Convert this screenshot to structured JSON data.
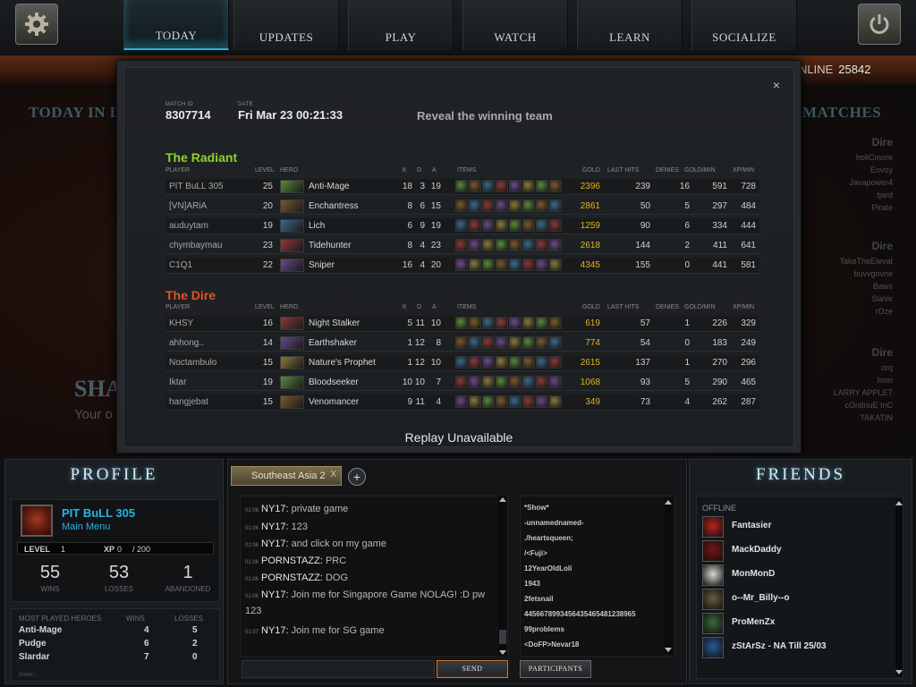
{
  "nav": {
    "tabs": [
      "TODAY",
      "UPDATES",
      "PLAY",
      "WATCH",
      "LEARN",
      "SOCIALIZE"
    ],
    "active": "TODAY",
    "settings_icon": "gear-icon",
    "power_icon": "power-icon"
  },
  "background": {
    "today_title": "TODAY IN D",
    "matches_title": "MATCHES",
    "online_label": "NLINE",
    "online_count": "25842",
    "headline": "SHA",
    "subline": "Your o",
    "right_groups": [
      {
        "title": "Dire",
        "names": [
          "holiCmore",
          "Envoy",
          "Javapower4",
          "tjard",
          "Pirate"
        ]
      },
      {
        "title": "Dire",
        "names": [
          "TakeTheElevat",
          "buvvgovne",
          "Baws",
          "SlaVe",
          "rOze"
        ]
      },
      {
        "title": "Dire",
        "names": [
          "orq",
          "Inori",
          "LARRY APPLET",
          "cOntinuE InC",
          "TAKATIN"
        ]
      }
    ]
  },
  "match": {
    "id_label": "MATCH ID",
    "id": "8307714",
    "date_label": "DATE",
    "date": "Fri Mar 23 00:21:33",
    "reveal": "Reveal the winning team",
    "close": "×",
    "columns": {
      "player": "PLAYER",
      "level": "LEVEL",
      "hero": "HERO",
      "k": "K",
      "d": "D",
      "a": "A",
      "items": "ITEMS",
      "gold": "GOLD",
      "last_hits": "LAST HITS",
      "denies": "DENIES",
      "gpm": "GOLD/MIN",
      "xpm": "XP/MIN"
    },
    "radiant": {
      "title": "The Radiant",
      "players": [
        {
          "player": "PIT BuLL 305",
          "level": "25",
          "hero": "Anti-Mage",
          "k": "18",
          "d": "3",
          "a": "19",
          "gold": "2396",
          "lh": "239",
          "den": "16",
          "gpm": "591",
          "xpm": "728"
        },
        {
          "player": "[VN]ARiA",
          "level": "20",
          "hero": "Enchantress",
          "k": "8",
          "d": "6",
          "a": "15",
          "gold": "2861",
          "lh": "50",
          "den": "5",
          "gpm": "297",
          "xpm": "484"
        },
        {
          "player": "auduytam",
          "level": "19",
          "hero": "Lich",
          "k": "6",
          "d": "9",
          "a": "19",
          "gold": "1259",
          "lh": "90",
          "den": "6",
          "gpm": "334",
          "xpm": "444"
        },
        {
          "player": "chymbaymau",
          "level": "23",
          "hero": "Tidehunter",
          "k": "8",
          "d": "4",
          "a": "23",
          "gold": "2618",
          "lh": "144",
          "den": "2",
          "gpm": "411",
          "xpm": "641"
        },
        {
          "player": "C1Q1",
          "level": "22",
          "hero": "Sniper",
          "k": "16",
          "d": "4",
          "a": "20",
          "gold": "4345",
          "lh": "155",
          "den": "0",
          "gpm": "441",
          "xpm": "581"
        }
      ]
    },
    "dire": {
      "title": "The Dire",
      "players": [
        {
          "player": "KHSY",
          "level": "16",
          "hero": "Night Stalker",
          "k": "5",
          "d": "11",
          "a": "10",
          "gold": "619",
          "lh": "57",
          "den": "1",
          "gpm": "226",
          "xpm": "329"
        },
        {
          "player": "ahhong..",
          "level": "14",
          "hero": "Earthshaker",
          "k": "1",
          "d": "12",
          "a": "8",
          "gold": "774",
          "lh": "54",
          "den": "0",
          "gpm": "183",
          "xpm": "249"
        },
        {
          "player": "Noctambulo",
          "level": "15",
          "hero": "Nature's Prophet",
          "k": "1",
          "d": "12",
          "a": "10",
          "gold": "2615",
          "lh": "137",
          "den": "1",
          "gpm": "270",
          "xpm": "296"
        },
        {
          "player": "Iktar",
          "level": "19",
          "hero": "Bloodseeker",
          "k": "10",
          "d": "10",
          "a": "7",
          "gold": "1068",
          "lh": "93",
          "den": "5",
          "gpm": "290",
          "xpm": "465"
        },
        {
          "player": "hangjebat",
          "level": "15",
          "hero": "Venomancer",
          "k": "9",
          "d": "11",
          "a": "4",
          "gold": "349",
          "lh": "73",
          "den": "4",
          "gpm": "262",
          "xpm": "287"
        }
      ]
    },
    "replay": "Replay Unavailable"
  },
  "profile": {
    "title": "PROFILE",
    "name": "PIT BuLL 305",
    "status": "Main Menu",
    "level_label": "LEVEL",
    "level": "1",
    "xp_label": "XP",
    "xp": "0",
    "xp_max": "/ 200",
    "wins": "55",
    "wins_label": "WINS",
    "losses": "53",
    "losses_label": "LOSSES",
    "abandoned": "1",
    "abandoned_label": "ABANDONED",
    "mph_label": "MOST PLAYED HEROES",
    "mph_wins_label": "WINS",
    "mph_losses_label": "LOSSES",
    "heroes": [
      {
        "name": "Anti-Mage",
        "wins": "4",
        "losses": "5"
      },
      {
        "name": "Pudge",
        "wins": "6",
        "losses": "2"
      },
      {
        "name": "Slardar",
        "wins": "7",
        "losses": "0"
      }
    ],
    "more": "more..."
  },
  "chat": {
    "tab": "Southeast Asia 2",
    "tab_close": "X",
    "add": "+",
    "messages": [
      {
        "time": "01:06",
        "name": "NY17:",
        "text": "private game"
      },
      {
        "time": "01:06",
        "name": "NY17:",
        "text": "123"
      },
      {
        "time": "01:06",
        "name": "NY17:",
        "text": "and click on my game"
      },
      {
        "time": "01:06",
        "name": "PORNSTAZZ:",
        "text": "PRC"
      },
      {
        "time": "01:06",
        "name": "PORNSTAZZ:",
        "text": "DOG"
      },
      {
        "time": "01:06",
        "name": "NY17:",
        "text": "Join me for Singapore Game NOLAG! :D pw 123"
      },
      {
        "time": "01:07",
        "name": "NY17:",
        "text": "Join me for SG game"
      }
    ],
    "participants": [
      "*Show*",
      "-unnamednamed-",
      "./heartsqueen;",
      "/<Fuji>",
      "12YearOldLoli",
      "1943",
      "2fetsnail",
      "4456678993456435465481238965",
      "99problems",
      "<DoFP>Nevar18"
    ],
    "send": "SEND",
    "participants_btn": "PARTICIPANTS"
  },
  "friends": {
    "title": "FRIENDS",
    "section": "OFFLINE",
    "list": [
      {
        "name": "Fantasier",
        "color": "#b8241a"
      },
      {
        "name": "MackDaddy",
        "color": "#7a1414"
      },
      {
        "name": "MonMonD",
        "color": "#d8d8d0"
      },
      {
        "name": "o--Mr_Billy--o",
        "color": "#6a5a40"
      },
      {
        "name": "ProMenZx",
        "color": "#3a6a3a"
      },
      {
        "name": "zStArSz - NA Till 25/03",
        "color": "#2a5a9a"
      }
    ]
  }
}
